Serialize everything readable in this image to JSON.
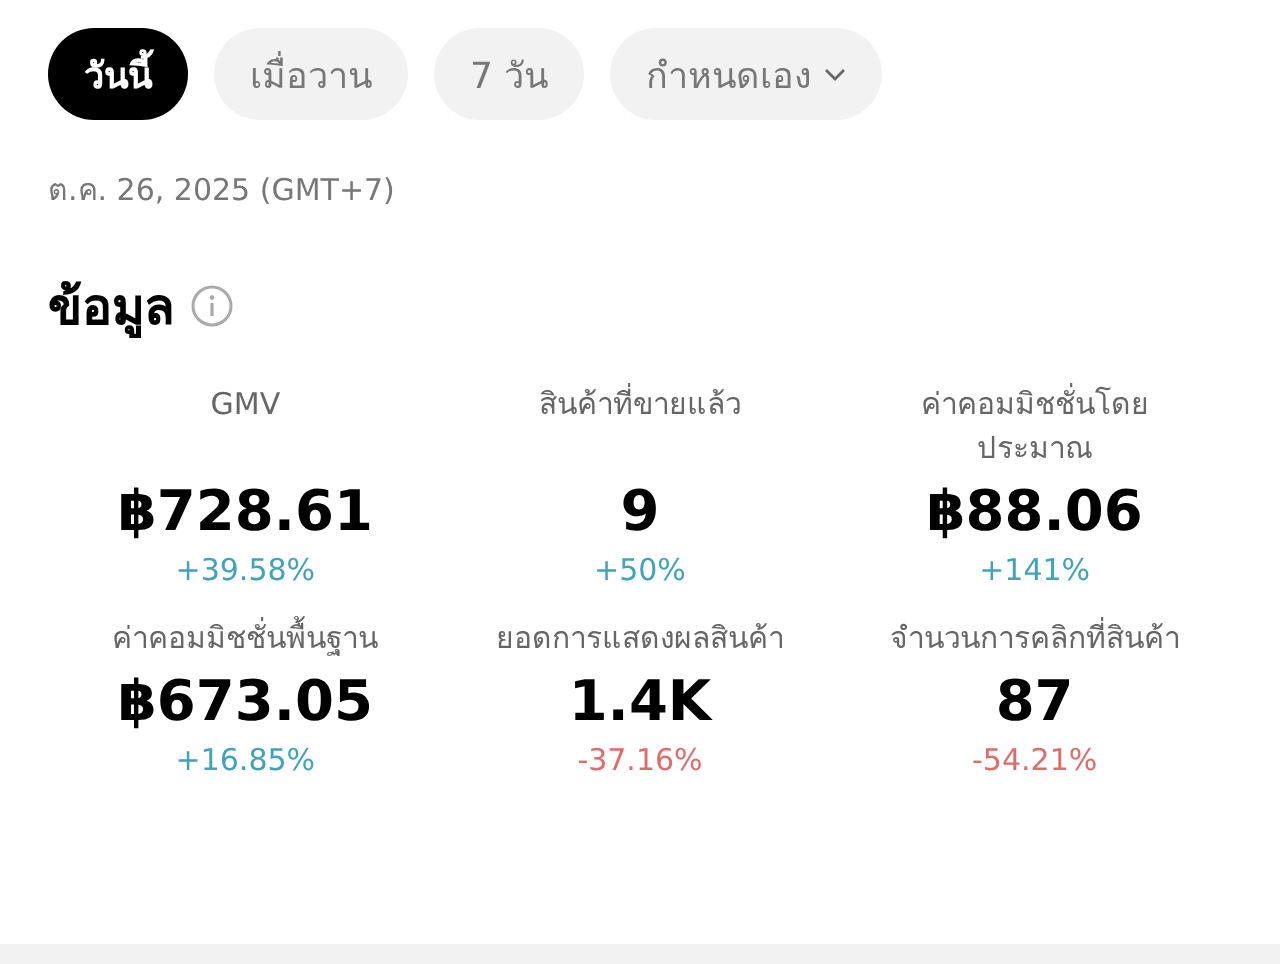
{
  "tabs": [
    {
      "label": "วันนี้",
      "selected": true,
      "dropdown": false
    },
    {
      "label": "เมื่อวาน",
      "selected": false,
      "dropdown": false
    },
    {
      "label": "7 วัน",
      "selected": false,
      "dropdown": false
    },
    {
      "label": "กำหนดเอง",
      "selected": false,
      "dropdown": true
    }
  ],
  "date": "ต.ค. 26, 2025 (GMT+7)",
  "section": {
    "title": "ข้อมูล"
  },
  "metrics": [
    {
      "label": "GMV",
      "value": "฿728.61",
      "change": "+39.58%",
      "color": "#3fa3b9"
    },
    {
      "label": "สินค้าที่ขายแล้ว",
      "value": "9",
      "change": "+50%",
      "color": "#3fa3b9"
    },
    {
      "label": "ค่าคอมมิชชั่นโดย\nประมาณ",
      "value": "฿88.06",
      "change": "+141%",
      "color": "#3fa3b9"
    },
    {
      "label": "ค่าคอมมิชชั่นพื้นฐาน",
      "value": "฿673.05",
      "change": "+16.85%",
      "color": "#3fa3b9"
    },
    {
      "label": "ยอดการแสดงผลสินค้า",
      "value": "1.4K",
      "change": "-37.16%",
      "color": "#e06b6b"
    },
    {
      "label": "จำนวนการคลิกที่สินค้า",
      "value": "87",
      "change": "-54.21%",
      "color": "#e06b6b"
    }
  ]
}
